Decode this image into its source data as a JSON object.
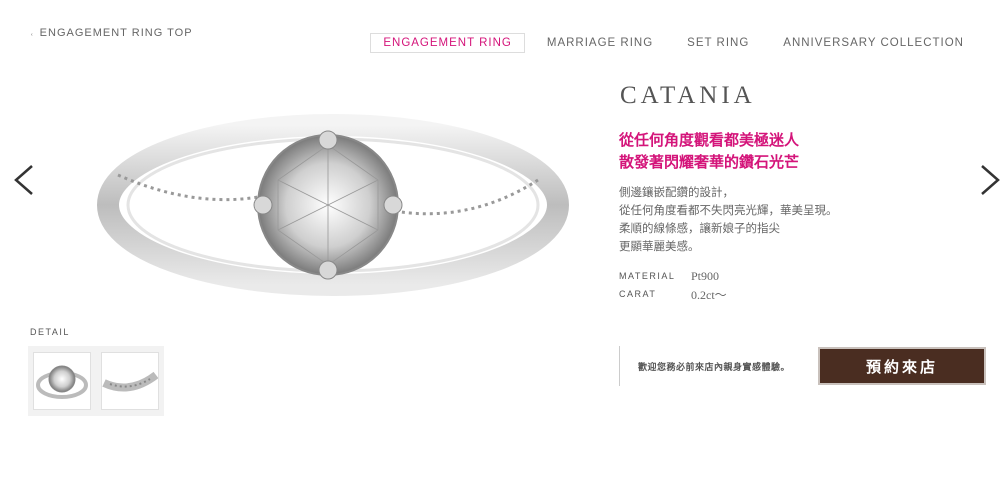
{
  "header": {
    "top_link_icon": "ring-icon",
    "top_link": "ENGAGEMENT RING TOP",
    "tabs": [
      "ENGAGEMENT RING",
      "MARRIAGE RING",
      "SET RING",
      "ANNIVERSARY COLLECTION"
    ],
    "active_tab": "ENGAGEMENT RING",
    "accent_color": "#d4147a"
  },
  "product": {
    "name": "CATANIA",
    "tagline": [
      "從任何角度觀看都美極迷人",
      "散發著閃耀奢華的鑽石光芒"
    ],
    "description": [
      "側邊鑲嵌配鑽的設計，",
      "從任何角度看都不失閃亮光輝，華美呈現。",
      "柔順的線條感，讓新娘子的指尖",
      "更顯華麗美感。"
    ],
    "specs": [
      {
        "key": "MATERIAL",
        "value": "Pt900"
      },
      {
        "key": "CARAT",
        "value": "0.2ct〜"
      }
    ]
  },
  "detail": {
    "label": "DETAIL"
  },
  "cta": {
    "notice": "歡迎您務必前來店內親身實感體驗。",
    "reserve_label": "預約來店",
    "reserve_color": "#4a2d21"
  },
  "nav_icons": [
    "chevron-left-icon",
    "chevron-right-icon"
  ]
}
